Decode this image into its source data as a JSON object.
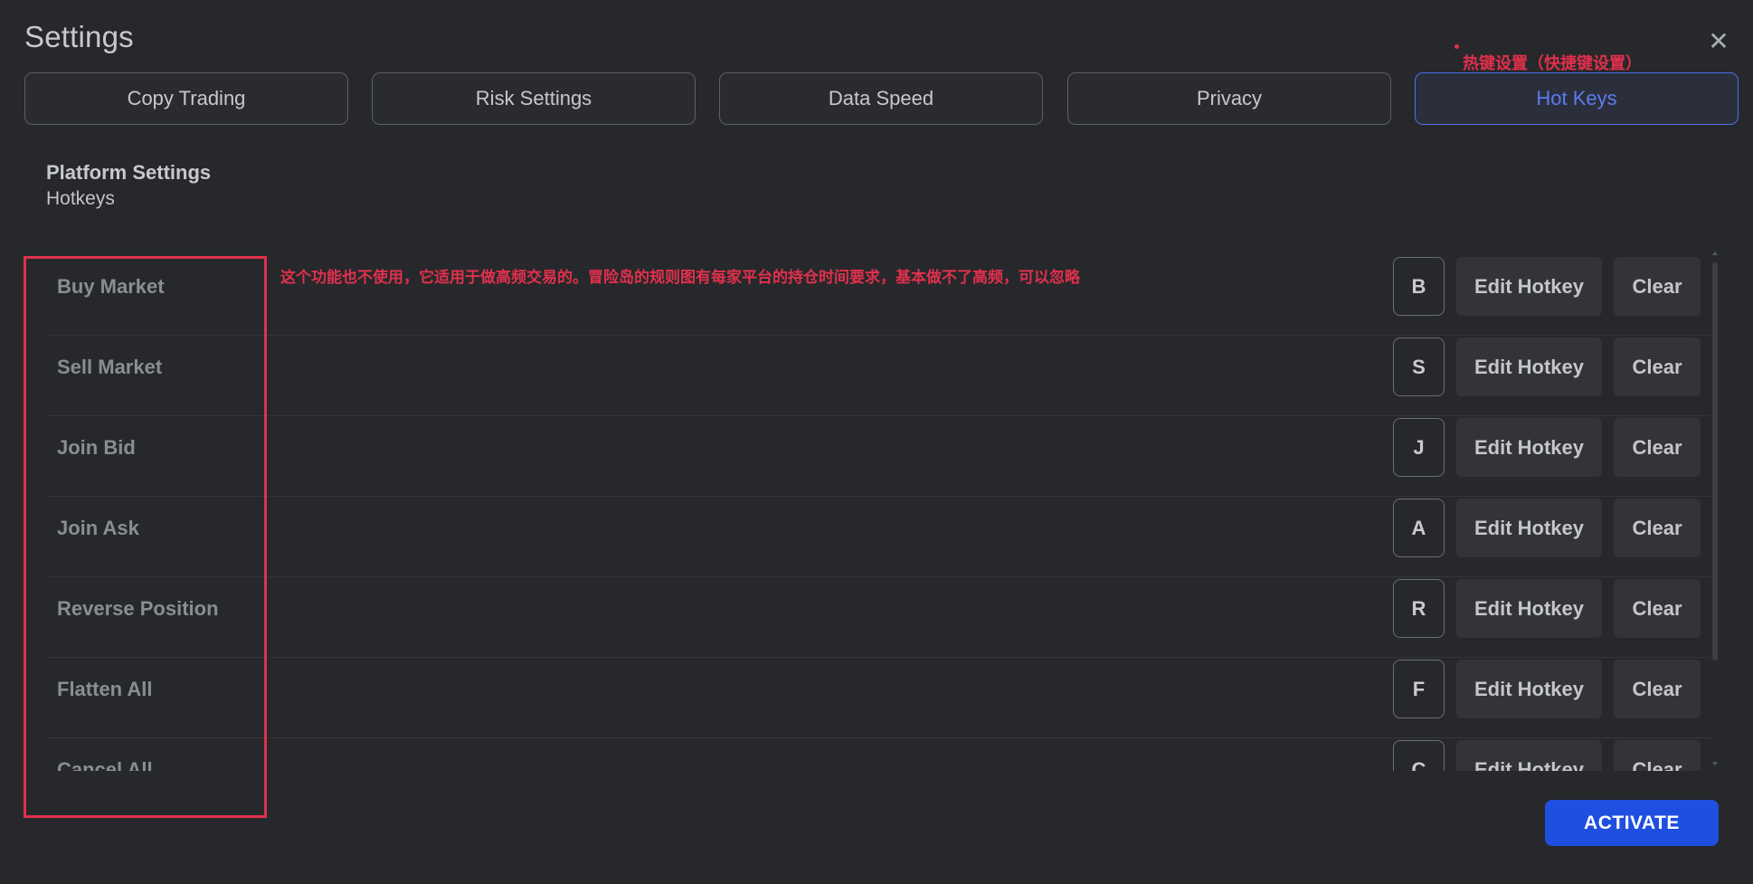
{
  "window": {
    "title": "Settings",
    "close_icon": "close-icon"
  },
  "annotations": {
    "tab_note": "热键设置（快捷键设置）",
    "row_note": "这个功能也不使用，它适用于做高频交易的。冒险岛的规则图有每家平台的持仓时间要求，基本做不了高频，可以忽略",
    "color": "#e0304c"
  },
  "tabs": [
    {
      "label": "Copy Trading",
      "active": false
    },
    {
      "label": "Risk Settings",
      "active": false
    },
    {
      "label": "Data Speed",
      "active": false
    },
    {
      "label": "Privacy",
      "active": false
    },
    {
      "label": "Hot Keys",
      "active": true
    }
  ],
  "section": {
    "title": "Platform Settings",
    "subtitle": "Hotkeys"
  },
  "hotkeys": [
    {
      "action": "Buy Market",
      "key": "B",
      "edit_label": "Edit Hotkey",
      "clear_label": "Clear"
    },
    {
      "action": "Sell Market",
      "key": "S",
      "edit_label": "Edit Hotkey",
      "clear_label": "Clear"
    },
    {
      "action": "Join Bid",
      "key": "J",
      "edit_label": "Edit Hotkey",
      "clear_label": "Clear"
    },
    {
      "action": "Join Ask",
      "key": "A",
      "edit_label": "Edit Hotkey",
      "clear_label": "Clear"
    },
    {
      "action": "Reverse Position",
      "key": "R",
      "edit_label": "Edit Hotkey",
      "clear_label": "Clear"
    },
    {
      "action": "Flatten All",
      "key": "F",
      "edit_label": "Edit Hotkey",
      "clear_label": "Clear"
    },
    {
      "action": "Cancel All",
      "key": "C",
      "edit_label": "Edit Hotkey",
      "clear_label": "Clear"
    }
  ],
  "footer": {
    "activate_label": "ACTIVATE"
  },
  "colors": {
    "background": "#27282b",
    "accent": "#1f4fe0",
    "active_tab": "#5b7cf0"
  }
}
